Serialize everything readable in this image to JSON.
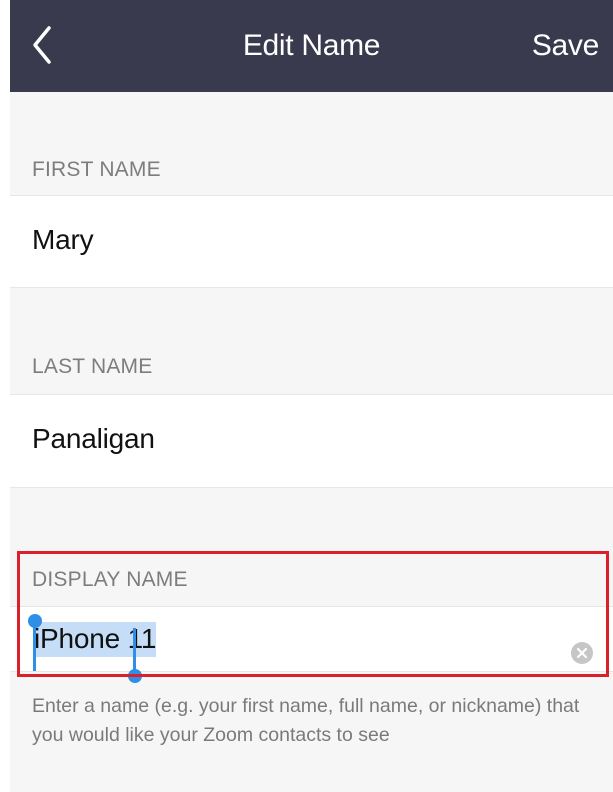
{
  "navbar": {
    "back_icon": "chevron-left-icon",
    "title": "Edit Name",
    "save_label": "Save"
  },
  "first_name": {
    "label": "FIRST NAME",
    "value": "Mary"
  },
  "last_name": {
    "label": "LAST NAME",
    "value": "Panaligan"
  },
  "display_name": {
    "label": "DISPLAY NAME",
    "value": "iPhone 11",
    "clear_icon": "clear-circle-icon",
    "helper": "Enter a name (e.g. your first name, full name, or nickname) that you would like your Zoom contacts to see"
  },
  "colors": {
    "navbar_bg": "#3a3a4f",
    "highlight_border": "#d9202b",
    "selection_bg": "#c5ddf7",
    "selection_handle": "#2f8fe6"
  }
}
